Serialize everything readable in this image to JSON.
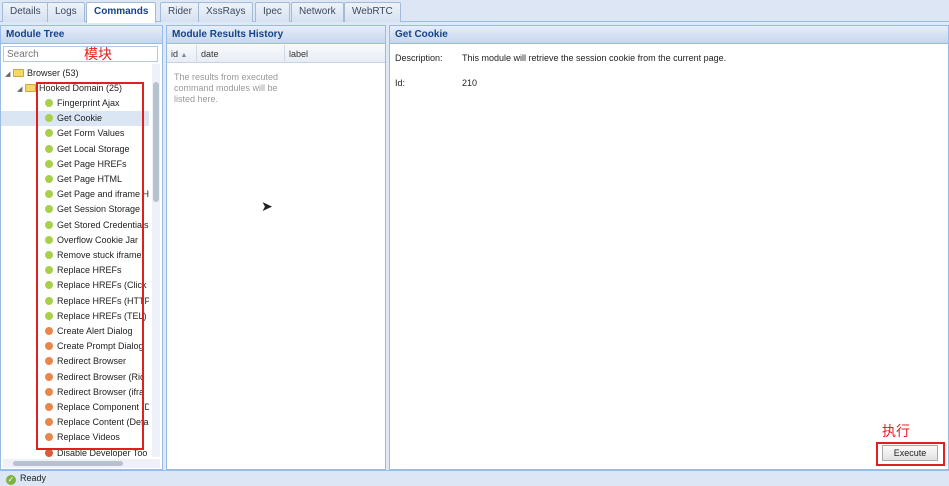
{
  "tabs": [
    "Details",
    "Logs",
    "Commands",
    "Rider",
    "XssRays",
    "Ipec",
    "Network",
    "WebRTC"
  ],
  "active_tab": "Commands",
  "module_tree": {
    "title": "Module Tree",
    "search_placeholder": "Search",
    "annotation": "模块",
    "root": "Browser (53)",
    "group": "Hooked Domain (25)",
    "items": [
      {
        "label": "Fingerprint Ajax",
        "color": "#a8d04a"
      },
      {
        "label": "Get Cookie",
        "color": "#a8d04a"
      },
      {
        "label": "Get Form Values",
        "color": "#a8d04a"
      },
      {
        "label": "Get Local Storage",
        "color": "#a8d04a"
      },
      {
        "label": "Get Page HREFs",
        "color": "#a8d04a"
      },
      {
        "label": "Get Page HTML",
        "color": "#a8d04a"
      },
      {
        "label": "Get Page and iframe H",
        "color": "#a8d04a"
      },
      {
        "label": "Get Session Storage",
        "color": "#a8d04a"
      },
      {
        "label": "Get Stored Credentials",
        "color": "#a8d04a"
      },
      {
        "label": "Overflow Cookie Jar",
        "color": "#a8d04a"
      },
      {
        "label": "Remove stuck iframe",
        "color": "#a8d04a"
      },
      {
        "label": "Replace HREFs",
        "color": "#a8d04a"
      },
      {
        "label": "Replace HREFs (Click",
        "color": "#a8d04a"
      },
      {
        "label": "Replace HREFs (HTTP",
        "color": "#a8d04a"
      },
      {
        "label": "Replace HREFs (TEL)",
        "color": "#a8d04a"
      },
      {
        "label": "Create Alert Dialog",
        "color": "#e8874a"
      },
      {
        "label": "Create Prompt Dialog",
        "color": "#e8874a"
      },
      {
        "label": "Redirect Browser",
        "color": "#e8874a"
      },
      {
        "label": "Redirect Browser (Ric",
        "color": "#e8874a"
      },
      {
        "label": "Redirect Browser (ifra",
        "color": "#e8874a"
      },
      {
        "label": "Replace Component (D",
        "color": "#e8874a"
      },
      {
        "label": "Replace Content (Defa",
        "color": "#e8874a"
      },
      {
        "label": "Replace Videos",
        "color": "#e8874a"
      },
      {
        "label": "Disable Developer Too",
        "color": "#e05a3a"
      }
    ]
  },
  "results": {
    "title": "Module Results History",
    "columns": [
      "id",
      "date",
      "label"
    ],
    "sort_indicator": "▲",
    "empty_message": "The results from executed command modules will be listed here."
  },
  "detail": {
    "title": "Get Cookie",
    "description_label": "Description:",
    "description": "This module will retrieve the session cookie from the current page.",
    "id_label": "Id:",
    "id_value": "210",
    "execute_label": "Execute",
    "annotation": "执行"
  },
  "status": {
    "text": "Ready"
  }
}
